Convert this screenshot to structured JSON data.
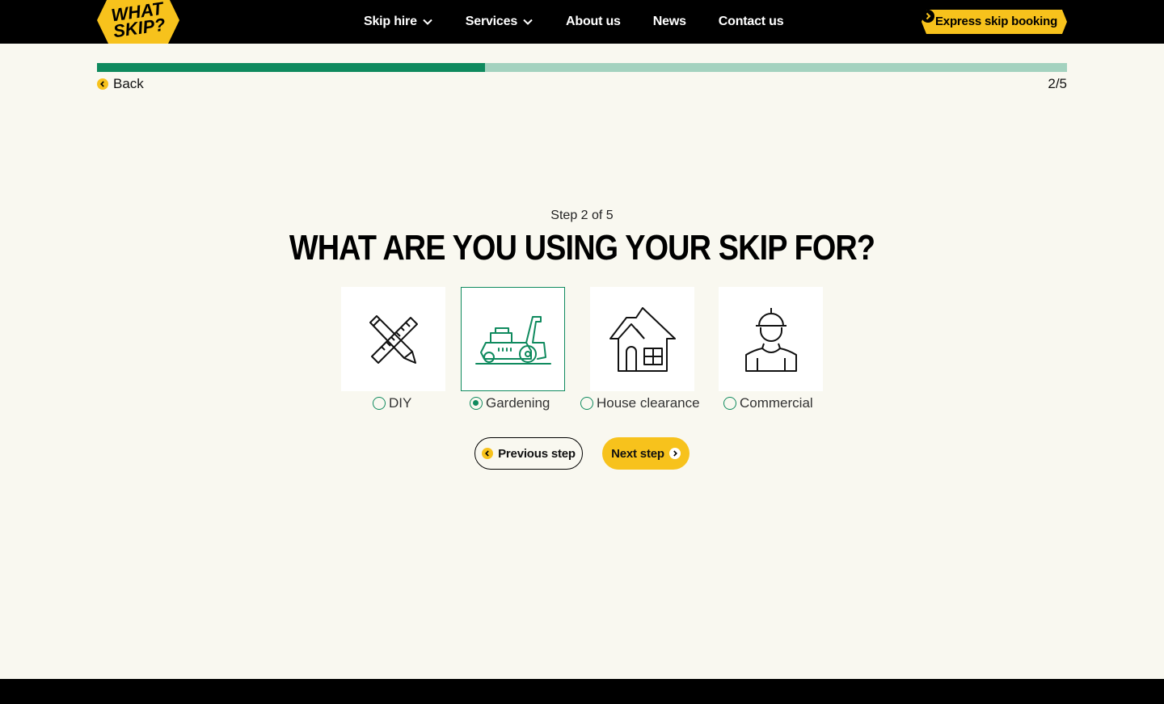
{
  "header": {
    "logo": {
      "line1": "WHAT",
      "line2": "SKIP?",
      "icon": "what-skip-logo"
    },
    "nav": [
      {
        "label": "Skip hire",
        "has_dropdown": true
      },
      {
        "label": "Services",
        "has_dropdown": true
      },
      {
        "label": "About us",
        "has_dropdown": false
      },
      {
        "label": "News",
        "has_dropdown": false
      },
      {
        "label": "Contact us",
        "has_dropdown": false
      }
    ],
    "cta_label": "Express skip booking"
  },
  "progress": {
    "fraction": 0.4,
    "back_label": "Back",
    "count_label": "2/5"
  },
  "form": {
    "step_label": "Step 2 of 5",
    "title": "What are you using your skip for?",
    "options": [
      {
        "label": "DIY",
        "icon": "pencil-ruler-icon",
        "selected": false
      },
      {
        "label": "Gardening",
        "icon": "lawnmower-icon",
        "selected": true
      },
      {
        "label": "House clearance",
        "icon": "house-icon",
        "selected": false
      },
      {
        "label": "Commercial",
        "icon": "worker-icon",
        "selected": false
      }
    ],
    "prev_label": "Previous step",
    "next_label": "Next step"
  },
  "colors": {
    "brand_yellow": "#f7c21c",
    "brand_green": "#0f8a5e",
    "progress_track": "#a4d2bf",
    "background": "#f9f8f0",
    "header_bg": "#000000"
  }
}
